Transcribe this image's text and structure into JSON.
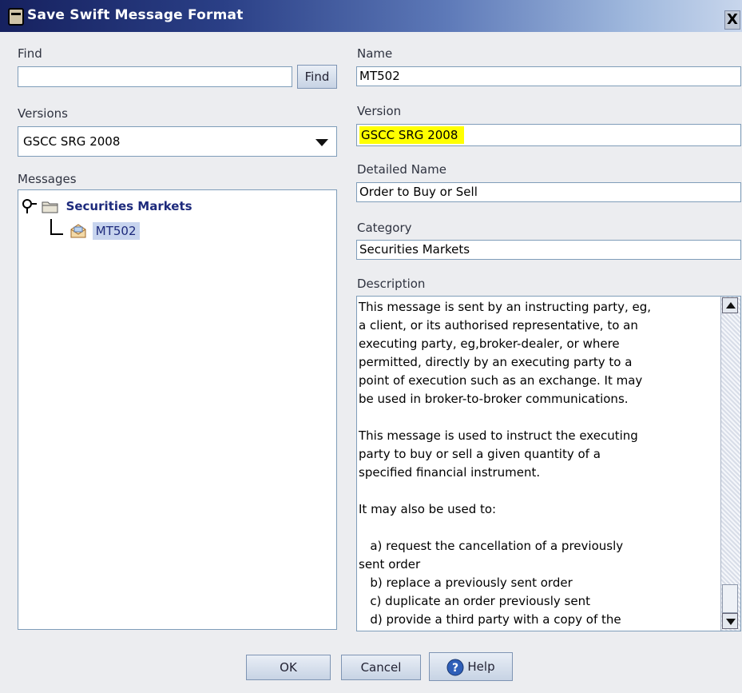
{
  "window": {
    "title": "Save Swift Message Format",
    "close_label": "X"
  },
  "find": {
    "label": "Find",
    "value": "",
    "button_label": "Find"
  },
  "versions": {
    "label": "Versions",
    "selected": "GSCC SRG 2008"
  },
  "messages": {
    "label": "Messages",
    "tree": {
      "folder_label": "Securities Markets",
      "item_label": "MT502"
    }
  },
  "name": {
    "label": "Name",
    "value": "MT502"
  },
  "version": {
    "label": "Version",
    "value": "GSCC SRG 2008",
    "highlight_color": "#ffff00"
  },
  "detailed_name": {
    "label": "Detailed Name",
    "value": "Order to Buy or Sell"
  },
  "category": {
    "label": "Category",
    "value": "Securities Markets"
  },
  "description": {
    "label": "Description",
    "text": "This message is sent by an instructing party, eg,\na client, or its authorised representative, to an\nexecuting party, eg,broker-dealer, or where\npermitted, directly by an executing party to a\npoint of execution such as an exchange. It may\nbe used in broker-to-broker communications.\n\nThis message is used to instruct the executing\nparty to buy or sell a given quantity of a\nspecified financial instrument.\n\nIt may also be used to:\n\n   a) request the cancellation of a previously\nsent order\n   b) replace a previously sent order\n   c) duplicate an order previously sent\n   d) provide a third party with a copy of the"
  },
  "buttons": {
    "ok": "OK",
    "cancel": "Cancel",
    "help": "Help"
  },
  "colors": {
    "title_bar": "#16215f",
    "tree_selected": "#c7d4ee",
    "tree_folder_text": "#1d2a7c"
  }
}
